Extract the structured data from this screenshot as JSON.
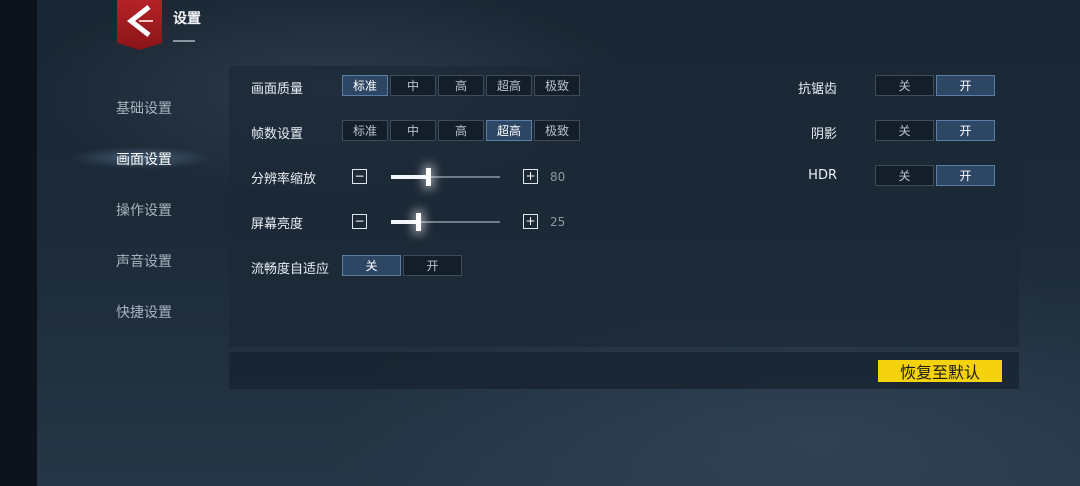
{
  "header": {
    "title": "设置"
  },
  "sidebar": {
    "items": [
      {
        "label": "基础设置",
        "active": false
      },
      {
        "label": "画面设置",
        "active": true
      },
      {
        "label": "操作设置",
        "active": false
      },
      {
        "label": "声音设置",
        "active": false
      },
      {
        "label": "快捷设置",
        "active": false
      }
    ]
  },
  "settings": {
    "quality": {
      "label": "画面质量",
      "options": [
        "标准",
        "中",
        "高",
        "超高",
        "极致"
      ],
      "selected": "标准"
    },
    "framerate": {
      "label": "帧数设置",
      "options": [
        "标准",
        "中",
        "高",
        "超高",
        "极致"
      ],
      "selected": "超高"
    },
    "resolution": {
      "label": "分辨率缩放",
      "value": "80",
      "minus": "−",
      "plus": "+"
    },
    "brightness": {
      "label": "屏幕亮度",
      "value": "25",
      "minus": "−",
      "plus": "+"
    },
    "adaptive": {
      "label": "流畅度自适应",
      "options": [
        "关",
        "开"
      ],
      "selected": "关"
    },
    "antialias": {
      "label": "抗锯齿",
      "options": [
        "关",
        "开"
      ],
      "selected": "开"
    },
    "shadow": {
      "label": "阴影",
      "options": [
        "关",
        "开"
      ],
      "selected": "开"
    },
    "hdr": {
      "label": "HDR",
      "options": [
        "关",
        "开"
      ],
      "selected": "开"
    }
  },
  "footer": {
    "reset_label": "恢复至默认"
  },
  "colors": {
    "accent_yellow": "#f5d20e",
    "selected_option": "#2c4664",
    "logo_red": "#b42226"
  }
}
